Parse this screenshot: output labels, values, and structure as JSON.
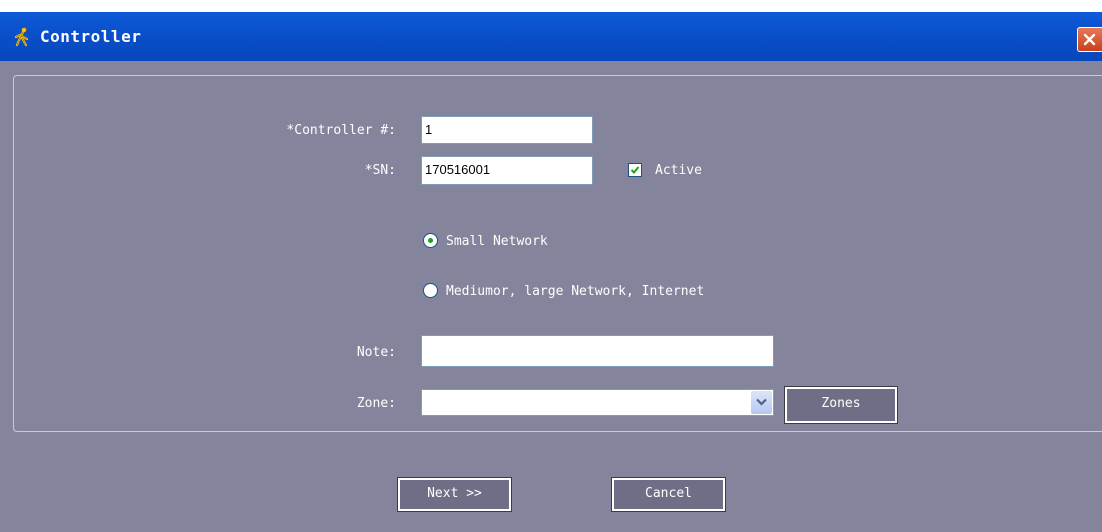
{
  "window": {
    "title": "Controller"
  },
  "form": {
    "controller_label": "*Controller #:",
    "controller_value": "1",
    "sn_label": "*SN:",
    "sn_value": "170516001",
    "active_label": "Active",
    "active_checked": true,
    "network_options": [
      {
        "label": "Small Network",
        "selected": true
      },
      {
        "label": "Mediumor, large Network, Internet",
        "selected": false
      }
    ],
    "note_label": "Note:",
    "note_value": "",
    "zone_label": "Zone:",
    "zone_value": "",
    "zones_button": "Zones"
  },
  "footer": {
    "next_button": "Next >>",
    "cancel_button": "Cancel"
  },
  "colors": {
    "title_bar": "#0a4fc9",
    "panel_background": "#84849c",
    "check_and_radio": "#21a121",
    "close_button": "#d8583a"
  },
  "icons": {
    "title": "controller-figure-icon",
    "close": "close-icon",
    "dropdown": "chevron-down-icon",
    "checkbox": "checkmark-icon"
  }
}
